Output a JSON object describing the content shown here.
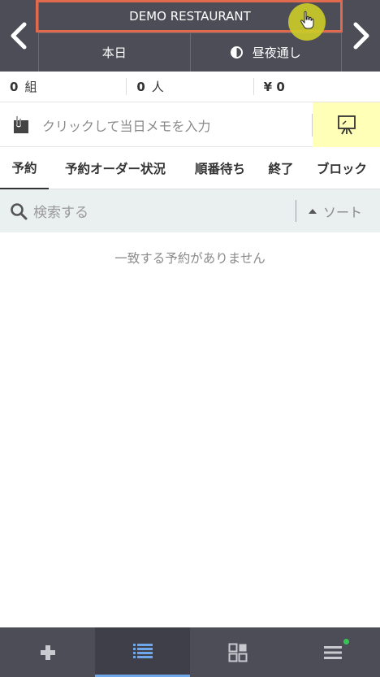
{
  "header": {
    "restaurant_name": "DEMO RESTAURANT",
    "date_label": "本日",
    "period_label": "昼夜通し"
  },
  "stats": {
    "groups_count": "0",
    "groups_unit": "組",
    "people_count": "0",
    "people_unit": "人",
    "sales": "¥ 0"
  },
  "memo": {
    "placeholder": "クリックして当日メモを入力"
  },
  "tabs": [
    {
      "label": "予約",
      "active": true
    },
    {
      "label": "予約オーダー状況"
    },
    {
      "label": "順番待ち"
    },
    {
      "label": "終了"
    },
    {
      "label": "ブロック"
    }
  ],
  "search": {
    "placeholder": "検索する",
    "sort_label": "ソート"
  },
  "empty_message": "一致する予約がありません",
  "bottom_nav": {
    "icons": [
      "plus-icon",
      "list-icon",
      "grid-icon",
      "menu-icon"
    ],
    "active_index": 1
  },
  "colors": {
    "header_bg": "#4c4d57",
    "highlight_border": "#e06a4d",
    "memo_button_bg": "#ffffb8",
    "active_indicator": "#6fa8ea",
    "notification_dot": "#39c556"
  }
}
